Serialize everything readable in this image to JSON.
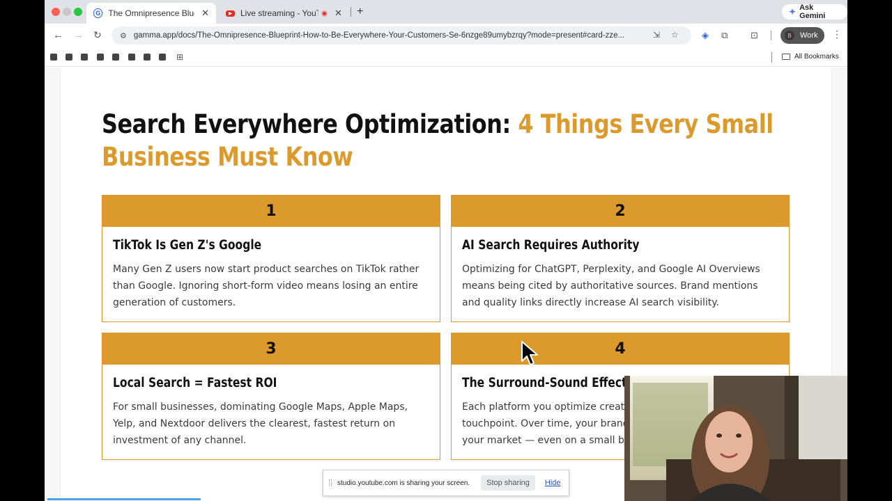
{
  "browser": {
    "tabs": [
      {
        "title": "The Omnipresence Blueprint",
        "favicon": "gamma-icon",
        "active": true
      },
      {
        "title": "Live streaming - YouTube",
        "favicon": "youtube-icon",
        "active": false
      }
    ],
    "ask_gemini": "Ask Gemini",
    "url": "gamma.app/docs/The-Omnipresence-Blueprint-How-to-Be-Everywhere-Your-Customers-Se-6nzge89umybzrqy?mode=present#card-zze...",
    "profile": {
      "initial": "B",
      "label": "Work"
    },
    "all_bookmarks": "All Bookmarks"
  },
  "slide": {
    "heading_main": "Search Everywhere Optimization: ",
    "heading_accent": "4 Things Every Small Business Must Know",
    "accent_color": "#dd9a2c",
    "cards": [
      {
        "number": "1",
        "title": "TikTok Is Gen Z's Google",
        "body": "Many Gen Z users now start product searches on TikTok rather than Google. Ignoring short-form video means losing an entire generation of customers."
      },
      {
        "number": "2",
        "title": "AI Search Requires Authority",
        "body": "Optimizing for ChatGPT, Perplexity, and Google AI Overviews means being cited by authoritative sources. Brand mentions and quality links directly increase AI search visibility."
      },
      {
        "number": "3",
        "title": "Local Search = Fastest ROI",
        "body": "For small businesses, dominating Google Maps, Apple Maps, Yelp, and Nextdoor delivers the clearest, fastest return on investment of any channel."
      },
      {
        "number": "4",
        "title": "The Surround-Sound Effect",
        "body": "Each platform you optimize creat\ntouchpoint. Over time, your brand\nyour market — even on a small bu"
      }
    ]
  },
  "share_bar": {
    "message": "studio.youtube.com is sharing your screen.",
    "stop_label": "Stop sharing",
    "hide_label": "Hide"
  }
}
